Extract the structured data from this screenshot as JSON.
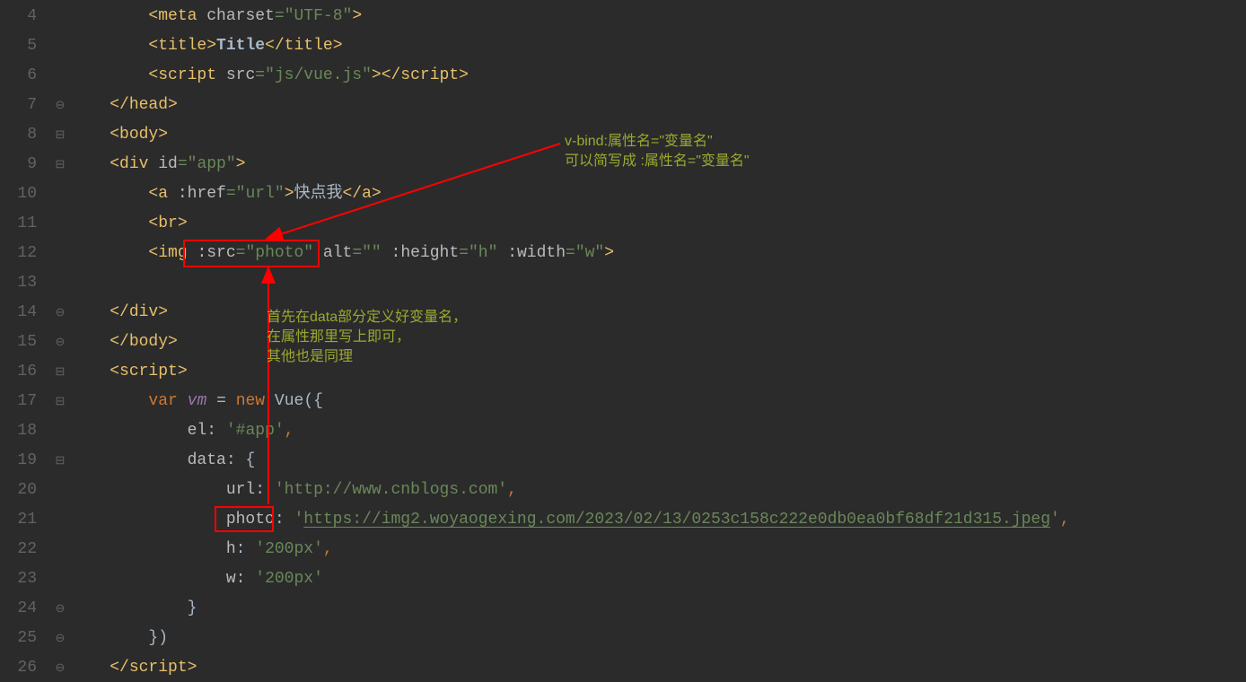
{
  "lineNumbers": [
    "4",
    "5",
    "6",
    "7",
    "8",
    "9",
    "10",
    "11",
    "12",
    "13",
    "14",
    "15",
    "16",
    "17",
    "18",
    "19",
    "20",
    "21",
    "22",
    "23",
    "24",
    "25",
    "26"
  ],
  "foldMarks": {
    "7": "⊖",
    "8": "⊟",
    "9": "⊟",
    "14": "⊖",
    "15": "⊖",
    "16": "⊟",
    "17": "⊟",
    "18": "",
    "19": "⊟",
    "24": "⊖",
    "25": "⊖",
    "26": "⊖"
  },
  "code": {
    "l4": {
      "indent": "        <",
      "tag": "meta",
      "sp": " ",
      "attr": "charset",
      "eq": "=",
      "val": "\"UTF-8\"",
      "close": ">"
    },
    "l5": {
      "indent": "        <",
      "tag": "title",
      "gt": ">",
      "txt": "Title",
      "lt": "</",
      "tag2": "title",
      "close": ">"
    },
    "l6": {
      "indent": "        <",
      "tag": "script",
      "sp": " ",
      "attr": "src",
      "eq": "=",
      "val": "\"js/vue.js\"",
      "gt": "></",
      "tag2": "script",
      "close": ">"
    },
    "l7": {
      "indent": "    </",
      "tag": "head",
      "close": ">"
    },
    "l8": {
      "indent": "    <",
      "tag": "body",
      "close": ">"
    },
    "l9": {
      "indent": "    <",
      "tag": "div",
      "sp": " ",
      "attr": "id",
      "eq": "=",
      "val": "\"app\"",
      "close": ">"
    },
    "l10": {
      "indent": "        <",
      "tag": "a",
      "sp": " ",
      "attr": ":href",
      "eq": "=",
      "val": "\"url\"",
      "gt": ">",
      "txt": "快点我",
      "lt": "</",
      "tag2": "a",
      "close": ">"
    },
    "l11": {
      "indent": "        <",
      "tag": "br",
      "close": ">"
    },
    "l12": {
      "indent": "        <",
      "tag": "img",
      "sp": " ",
      "attr1": ":src",
      "eq1": "=",
      "val1": "\"photo\"",
      "sp2": " ",
      "attr2": "alt",
      "eq2": "=",
      "val2": "\"\"",
      "sp3": " ",
      "attr3": ":height",
      "eq3": "=",
      "val3": "\"h\"",
      "sp4": " ",
      "attr4": ":width",
      "eq4": "=",
      "val4": "\"w\"",
      "close": ">"
    },
    "l13": {
      "indent": ""
    },
    "l14": {
      "indent": "    </",
      "tag": "div",
      "close": ">"
    },
    "l15": {
      "indent": "    </",
      "tag": "body",
      "close": ">"
    },
    "l16": {
      "indent": "    <",
      "tag": "script",
      "close": ">"
    },
    "l17": {
      "indent": "        ",
      "kw1": "var",
      "sp": " ",
      "var": "vm",
      "sp2": " ",
      "eq": "=",
      "sp3": " ",
      "kw2": "new",
      "sp4": " ",
      "fn": "Vue",
      "paren": "({"
    },
    "l18": {
      "indent": "            ",
      "key": "el",
      "colon": ":",
      "sp": " ",
      "val": "'#app'",
      "comma": ","
    },
    "l19": {
      "indent": "            ",
      "key": "data",
      "colon": ":",
      "sp": " ",
      "brace": "{"
    },
    "l20": {
      "indent": "                ",
      "key": "url",
      "colon": ":",
      "sp": " ",
      "val": "'http://www.cnblogs.com'",
      "comma": ","
    },
    "l21": {
      "indent": "                ",
      "key": "photo",
      "colon": ":",
      "sp": " ",
      "q": "'",
      "url": "https://img2.woyaogexing.com/2023/02/13/0253c158c222e0db0ea0bf68df21d315.jpeg",
      "q2": "'",
      "comma": ","
    },
    "l22": {
      "indent": "                ",
      "key": "h",
      "colon": ":",
      "sp": " ",
      "val": "'200px'",
      "comma": ","
    },
    "l23": {
      "indent": "                ",
      "key": "w",
      "colon": ":",
      "sp": " ",
      "val": "'200px'"
    },
    "l24": {
      "indent": "            ",
      "brace": "}"
    },
    "l25": {
      "indent": "        ",
      "brace": "})"
    },
    "l26": {
      "indent": "    </",
      "tag": "script",
      "close": ">"
    }
  },
  "annotations": {
    "a1_line1": "v-bind:属性名=\"变量名\"",
    "a1_line2": "可以简写成 :属性名=\"变量名\"",
    "a2_line1": "首先在data部分定义好变量名，",
    "a2_line2": "在属性那里写上即可，",
    "a2_line3": "其他也是同理"
  }
}
